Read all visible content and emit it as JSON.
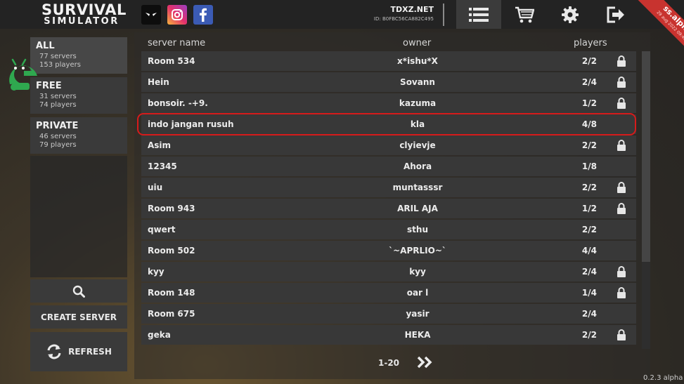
{
  "app": {
    "logo_line1": "SURVIVAL",
    "logo_line2": "SIMULATOR",
    "brand_ribbon": {
      "title": "ss.alpha",
      "date": "29 aug 2022 09:40"
    },
    "version": "0.2.3 alpha",
    "accent": "#c8332f"
  },
  "account": {
    "name": "TDXZ.NET",
    "id": "ID: B0FBC56CA882C495"
  },
  "top_icons": [
    "menu-icon",
    "cart-icon",
    "gear-icon",
    "exit-icon"
  ],
  "social_icons": [
    "eyes-icon",
    "instagram-icon",
    "facebook-icon"
  ],
  "categories": [
    {
      "title": "ALL",
      "servers": "77 servers",
      "players": "153 players"
    },
    {
      "title": "FREE",
      "servers": "31 servers",
      "players": "74 players"
    },
    {
      "title": "PRIVATE",
      "servers": "46 servers",
      "players": "79 players"
    }
  ],
  "buttons": {
    "create": "CREATE SERVER",
    "refresh": "REFRESH"
  },
  "table": {
    "headers": {
      "name": "server name",
      "owner": "owner",
      "players": "players"
    },
    "rows": [
      {
        "name": "Room 534",
        "owner": "x*ishu*X",
        "players": "2/2",
        "locked": true
      },
      {
        "name": "Hein",
        "owner": "Sovann",
        "players": "2/4",
        "locked": true
      },
      {
        "name": "bonsoir.        -+9.",
        "owner": "kazuma",
        "players": "1/2",
        "locked": true
      },
      {
        "name": "indo jangan rusuh",
        "owner": "kla",
        "players": "4/8",
        "locked": false
      },
      {
        "name": "Asim",
        "owner": "clyievje",
        "players": "2/2",
        "locked": true
      },
      {
        "name": "12345",
        "owner": "Ahora",
        "players": "1/8",
        "locked": false
      },
      {
        "name": "uiu",
        "owner": "muntasssr",
        "players": "2/2",
        "locked": true
      },
      {
        "name": "Room 943",
        "owner": "ARIL AJA",
        "players": "1/2",
        "locked": true
      },
      {
        "name": "qwert",
        "owner": "sthu",
        "players": "2/2",
        "locked": false
      },
      {
        "name": "Room 502",
        "owner": "`~APRLIO~`",
        "players": "4/4",
        "locked": false
      },
      {
        "name": "kyy",
        "owner": "kyy",
        "players": "2/4",
        "locked": true
      },
      {
        "name": "Room 148",
        "owner": "oar l",
        "players": "1/4",
        "locked": true
      },
      {
        "name": "Room 675",
        "owner": "yasir",
        "players": "2/4",
        "locked": false
      },
      {
        "name": "geka",
        "owner": "HEKA",
        "players": "2/2",
        "locked": true
      }
    ]
  },
  "pager": {
    "range": "1-20"
  }
}
